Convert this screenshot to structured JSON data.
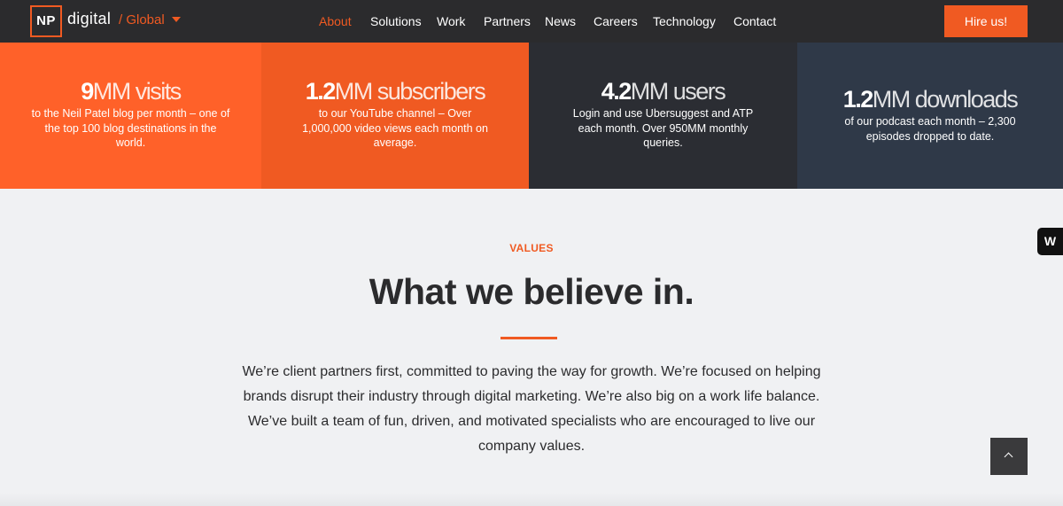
{
  "nav": {
    "logo_mark": "NP",
    "logo_word": "digital",
    "region": "/ Global",
    "items": [
      {
        "label": "About",
        "active": true
      },
      {
        "label": "Solutions",
        "active": false
      },
      {
        "label": "Work",
        "active": false
      },
      {
        "label": "Partners",
        "active": false
      },
      {
        "label": "News",
        "active": false
      },
      {
        "label": "Careers",
        "active": false
      },
      {
        "label": "Technology",
        "active": false
      },
      {
        "label": "Contact",
        "active": false
      }
    ],
    "cta": "Hire us!"
  },
  "stats": [
    {
      "number": "9",
      "unit": "MM visits",
      "desc": "to the Neil Patel blog per month – one of the top 100 blog destinations in the world.",
      "bg": "#ff6129"
    },
    {
      "number": "1.2",
      "unit": "MM subscribers",
      "desc": "to our YouTube channel – Over 1,000,000 video views each month on average.",
      "bg": "#f05a22"
    },
    {
      "number": "4.2",
      "unit": "MM users",
      "desc": "Login and use Ubersuggest and ATP each month. Over 950MM monthly queries.",
      "bg": "#2b2d33"
    },
    {
      "number": "1.2",
      "unit": "MM downloads",
      "desc": "of our podcast each month – 2,300 episodes dropped to date.",
      "bg": "#2f3948"
    }
  ],
  "values": {
    "label": "VALUES",
    "headline": "What we believe in.",
    "paragraph": "We’re client partners first, committed to paving the way for growth. We’re focused on helping brands disrupt their industry through digital marketing. We’re also big on a work life balance. We’ve built a team of fun, driven, and motivated specialists who are encouraged to live our company values."
  },
  "widgets": {
    "side_badge": "W",
    "back_to_top_icon": "chevron-up-icon"
  },
  "colors": {
    "accent": "#f05a22",
    "nav_bg": "#2b2b2d",
    "page_bg": "#f0f1f3"
  }
}
